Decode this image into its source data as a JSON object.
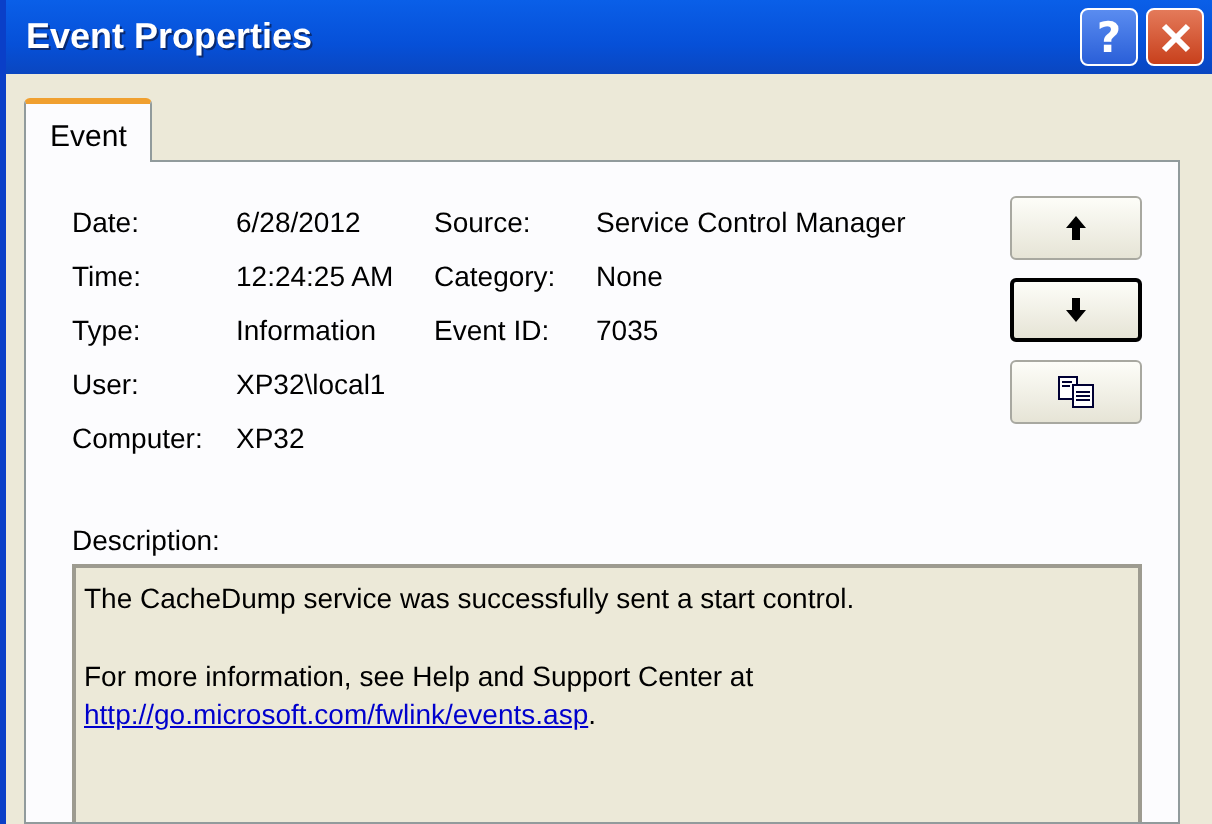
{
  "window": {
    "title": "Event Properties",
    "help_button": "?"
  },
  "tabs": [
    {
      "label": "Event",
      "selected": true
    }
  ],
  "fields": [
    {
      "label": "Date:",
      "value": "6/28/2012",
      "label_2": "Source:",
      "value_2": "Service Control Manager"
    },
    {
      "label": "Time:",
      "value": "12:24:25 AM",
      "label_2": "Category:",
      "value_2": "None"
    },
    {
      "label": "Type:",
      "value": "Information",
      "label_2": "Event ID:",
      "value_2": "7035"
    },
    {
      "label": "User:",
      "value": "XP32\\local1"
    },
    {
      "label": "Computer:",
      "value": "XP32"
    }
  ],
  "buttons": [
    {
      "kind": "up",
      "default": false
    },
    {
      "kind": "down",
      "default": true
    },
    {
      "kind": "copy",
      "default": false
    }
  ],
  "description": {
    "label": "Description:",
    "paragraphs": [
      "The CacheDump service was successfully sent a start control.",
      "For more information, see Help and Support Center at"
    ],
    "link": "http://go.microsoft.com/fwlink/events.asp",
    "link_suffix": "."
  }
}
